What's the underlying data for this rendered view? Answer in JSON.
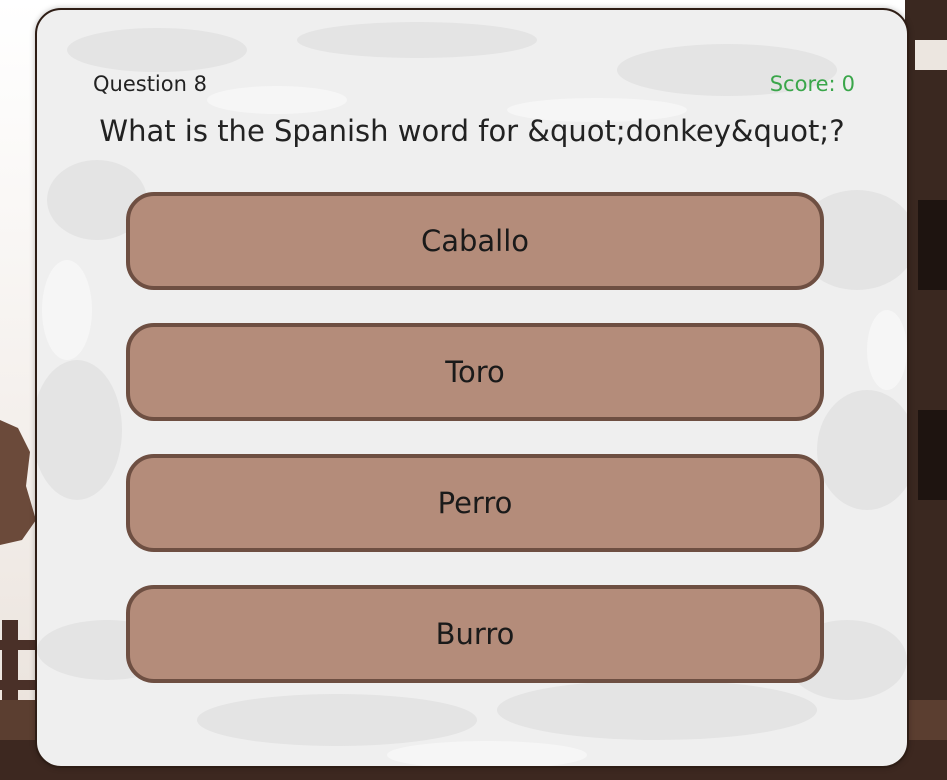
{
  "quiz": {
    "question_label": "Question 8",
    "score_label": "Score:",
    "score_value": "0",
    "question_text": "What is the Spanish word for &quot;donkey&quot;?",
    "answers": [
      {
        "label": "Caballo"
      },
      {
        "label": "Toro"
      },
      {
        "label": "Perro"
      },
      {
        "label": "Burro"
      }
    ]
  },
  "colors": {
    "card_background": "#efefef",
    "answer_fill": "#b48c7a",
    "answer_border": "#6e4f42",
    "score_text": "#3aa64a",
    "card_border": "#2e1d15"
  }
}
